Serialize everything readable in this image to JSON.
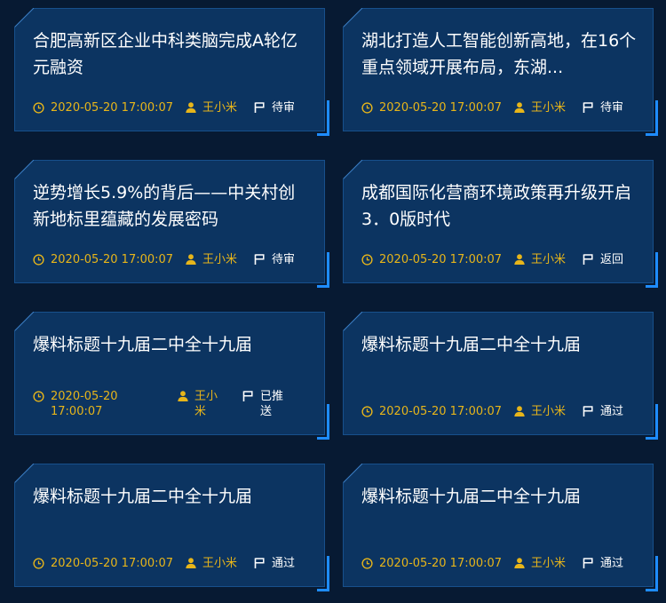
{
  "cards": [
    {
      "title": "合肥高新区企业中科类脑完成A轮亿元融资",
      "time": "2020-05-20 17:00:07",
      "author": "王小米",
      "status": "待审"
    },
    {
      "title": "湖北打造人工智能创新高地，在16个重点领域开展布局，东湖...",
      "time": "2020-05-20 17:00:07",
      "author": "王小米",
      "status": "待审"
    },
    {
      "title": "逆势增长5.9%的背后——中关村创新地标里蕴藏的发展密码",
      "time": "2020-05-20 17:00:07",
      "author": "王小米",
      "status": "待审"
    },
    {
      "title": "成都国际化营商环境政策再升级开启3．0版时代",
      "time": "2020-05-20 17:00:07",
      "author": "王小米",
      "status": "返回"
    },
    {
      "title": "爆料标题十九届二中全十九届",
      "time": "2020-05-20 17:00:07",
      "author": "王小米",
      "status": "已推送"
    },
    {
      "title": "爆料标题十九届二中全十九届",
      "time": "2020-05-20 17:00:07",
      "author": "王小米",
      "status": "通过"
    },
    {
      "title": "爆料标题十九届二中全十九届",
      "time": "2020-05-20 17:00:07",
      "author": "王小米",
      "status": "通过"
    },
    {
      "title": "爆料标题十九届二中全十九届",
      "time": "2020-05-20 17:00:07",
      "author": "王小米",
      "status": "通过"
    }
  ],
  "icons": {
    "time": "clock-icon",
    "author": "user-icon",
    "status": "flag-icon"
  },
  "colors": {
    "page_background": "#071a33",
    "card_background": "#0c3461",
    "card_border": "#17508c",
    "accent": "#1e8cff",
    "meta_text": "#e7b51a",
    "title_text": "#ffffff"
  }
}
